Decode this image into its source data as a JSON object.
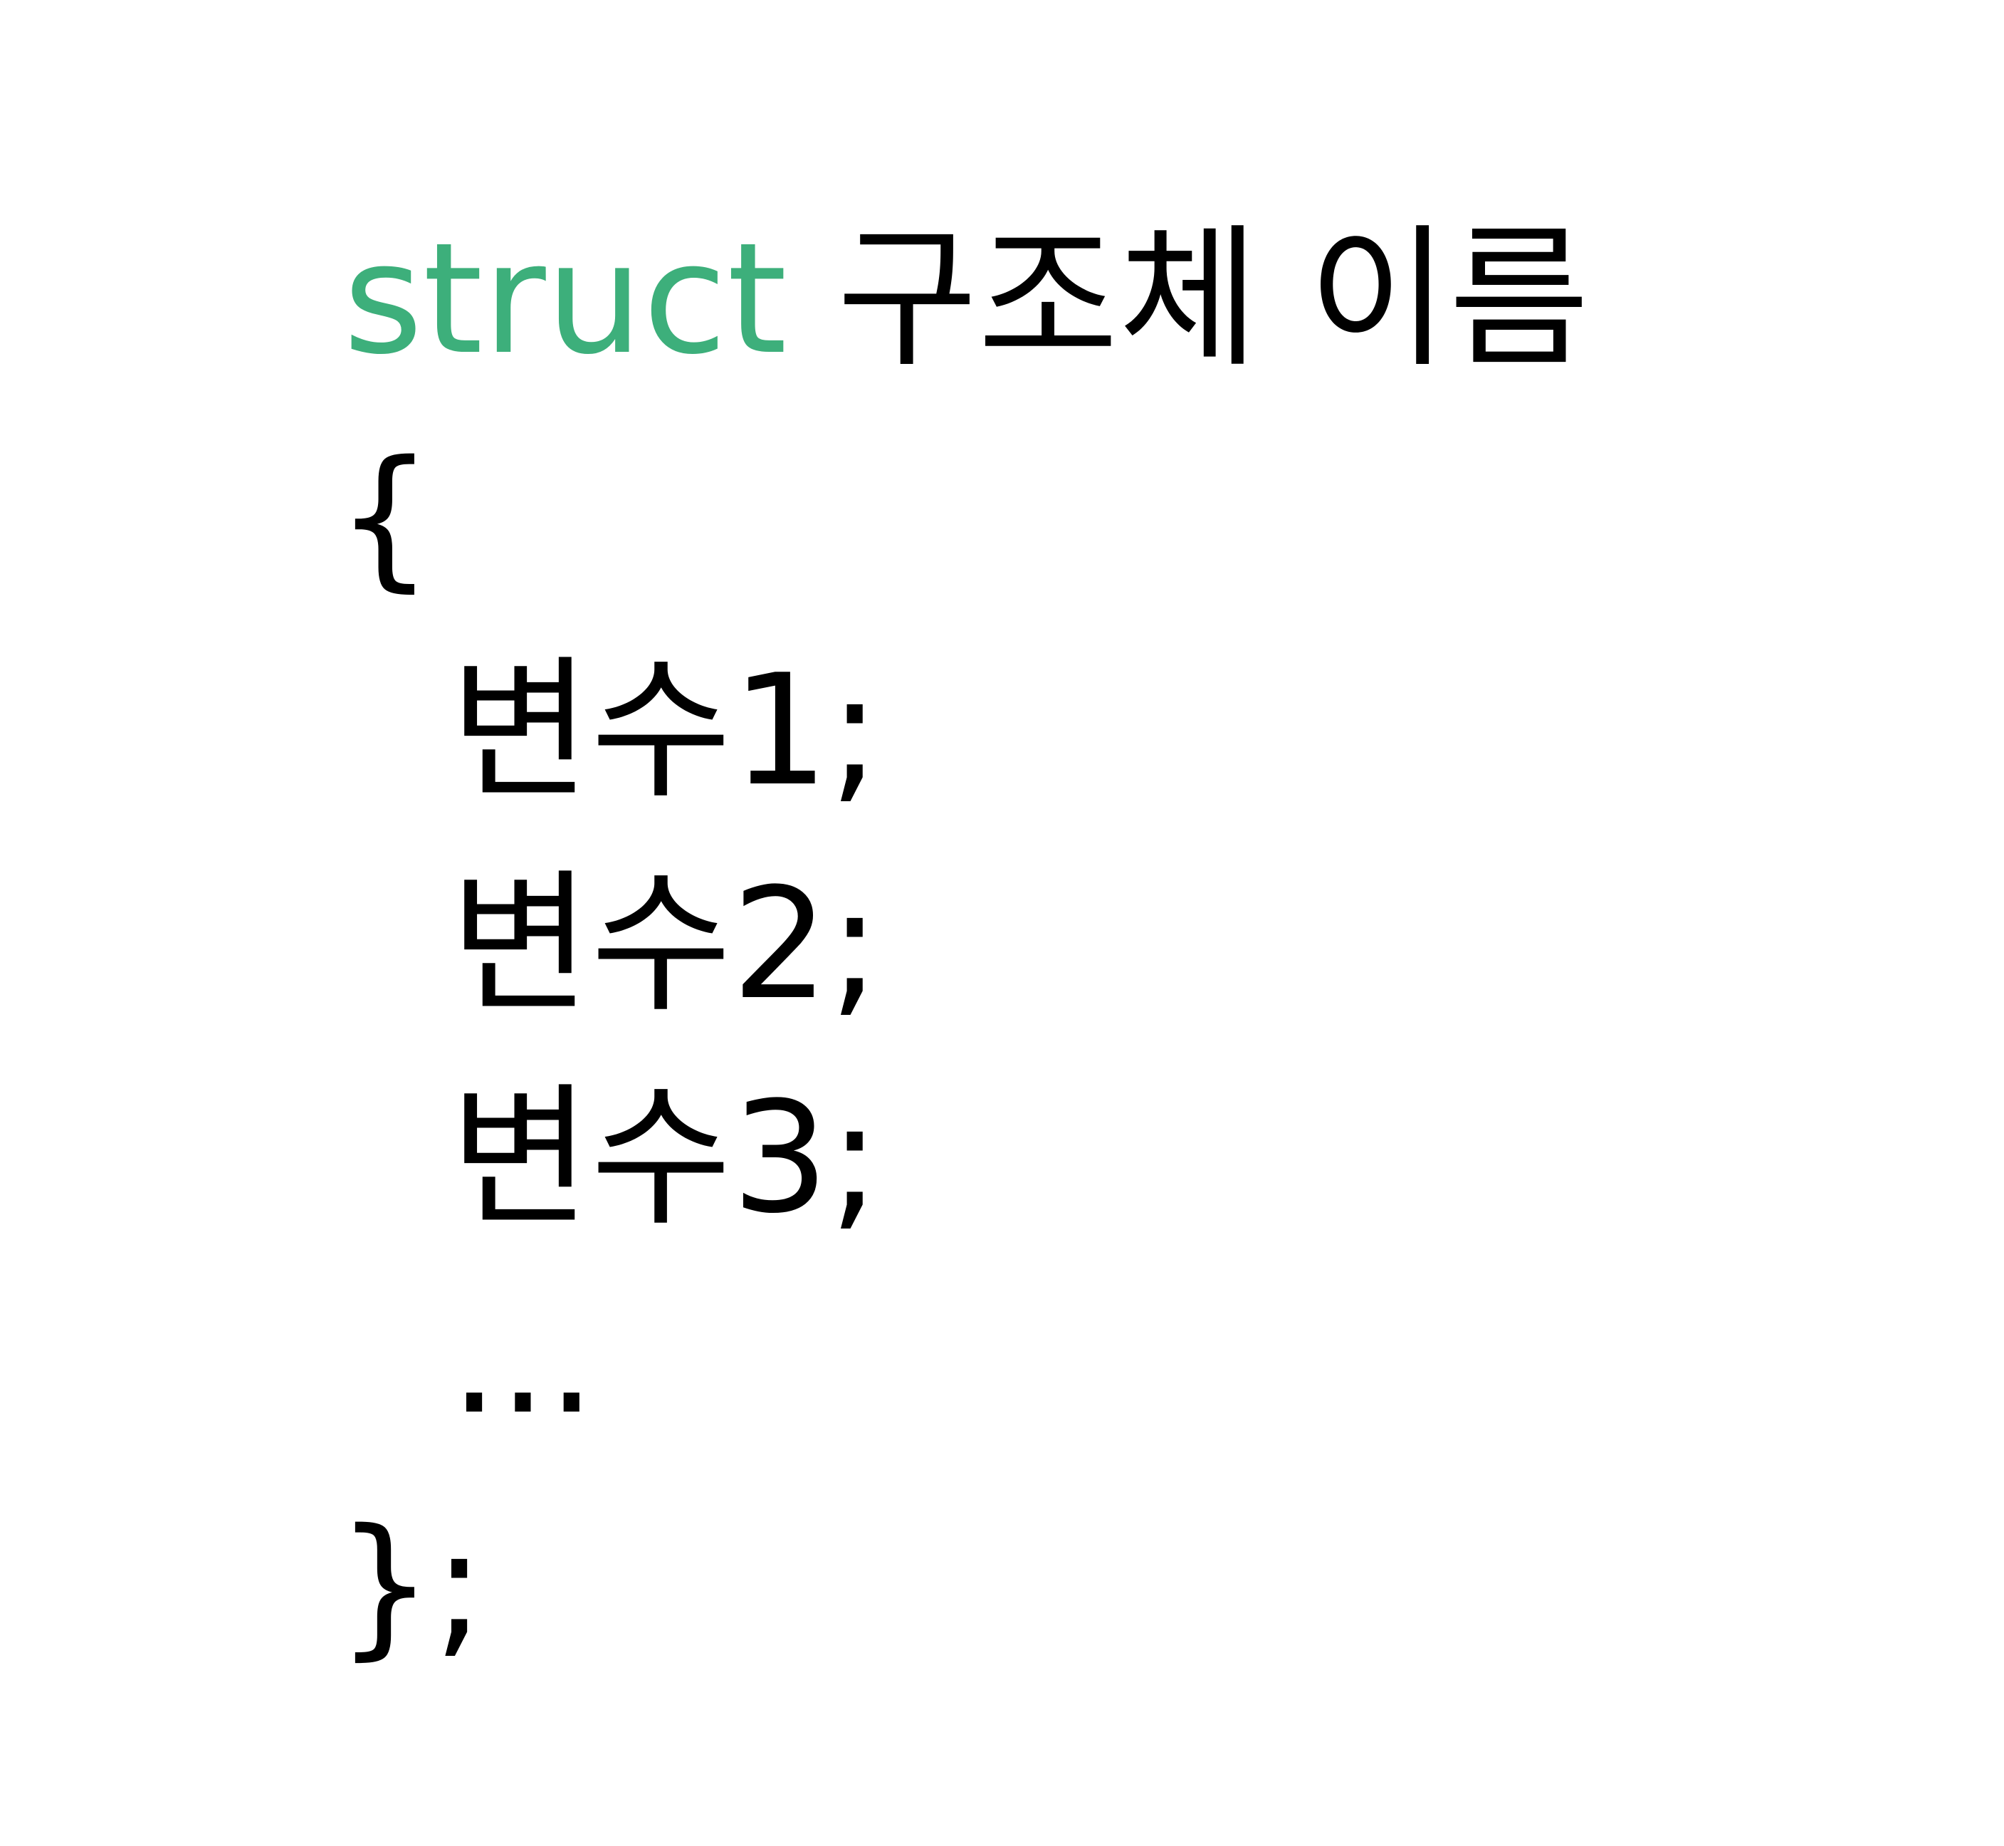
{
  "code": {
    "keyword": "struct",
    "struct_name": "구조체 이름",
    "open_brace": "{",
    "members": [
      "변수1;",
      "변수2;",
      "변수3;"
    ],
    "ellipsis": "...",
    "close": "};"
  },
  "colors": {
    "keyword": "#3daf7b",
    "text": "#000000",
    "background": "#ffffff"
  }
}
